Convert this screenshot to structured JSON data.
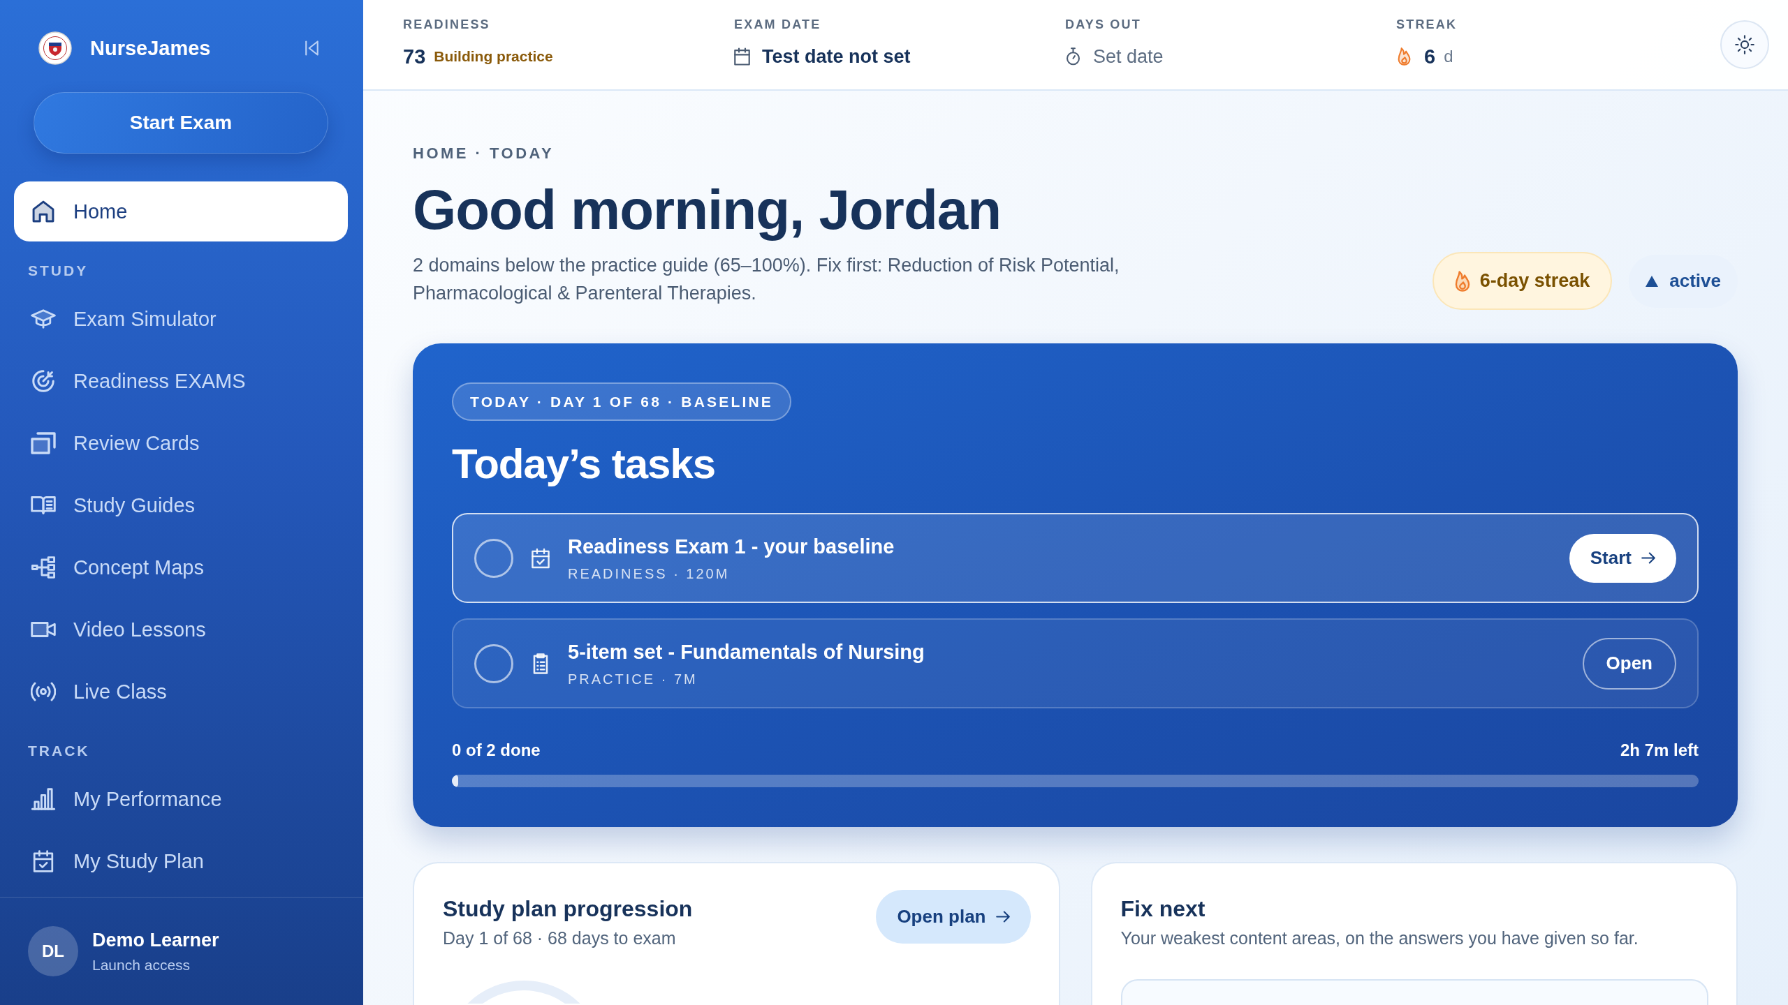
{
  "sidebar": {
    "brand": "NurseJames",
    "start_button": "Start Exam",
    "home": {
      "label": "Home",
      "selected": true
    },
    "sections": [
      {
        "heading": "STUDY",
        "items": [
          {
            "label": "Exam Simulator",
            "selected": false
          },
          {
            "label": "Readiness EXAMS",
            "selected": false
          },
          {
            "label": "Review Cards",
            "selected": false
          },
          {
            "label": "Study Guides",
            "selected": false
          },
          {
            "label": "Concept Maps",
            "selected": false
          },
          {
            "label": "Video Lessons",
            "selected": false
          },
          {
            "label": "Live Class",
            "selected": false
          }
        ]
      },
      {
        "heading": "TRACK",
        "items": [
          {
            "label": "My Performance",
            "selected": false
          },
          {
            "label": "My Study Plan",
            "selected": false
          }
        ]
      }
    ],
    "user": {
      "initials": "DL",
      "name": "Demo Learner",
      "plan": "Launch access"
    }
  },
  "top_bar": {
    "stats": [
      {
        "kind": "score",
        "label": "READINESS",
        "value": "73",
        "note": "Building practice"
      },
      {
        "kind": "date",
        "label": "EXAM DATE",
        "value": "Test date not set"
      },
      {
        "kind": "countdown",
        "label": "DAYS OUT",
        "value": "Set date"
      },
      {
        "kind": "streak",
        "label": "STREAK",
        "value": "6",
        "unit": "d"
      }
    ]
  },
  "header": {
    "breadcrumb": "HOME · TODAY",
    "title": "Good morning, Jordan",
    "summary": "2 domains below the practice guide (65–100%). Fix first: Reduction of Risk Potential, Pharmacological & Parenteral Therapies.",
    "streak_badge": "6-day streak",
    "status_badge": "active"
  },
  "tasks_card": {
    "tag": "TODAY · DAY 1 OF 68 · BASELINE",
    "title": "Today’s tasks",
    "tasks": [
      {
        "kind": "exam",
        "title": "Readiness Exam 1 - your baseline",
        "meta": "READINESS · 120M",
        "checked": false,
        "highlighted": true,
        "action": "Start"
      },
      {
        "kind": "practice",
        "title": "5-item set - Fundamentals of Nursing",
        "meta": "PRACTICE · 7M",
        "checked": false,
        "highlighted": false,
        "action": "Open"
      }
    ],
    "done_text": "0 of 2 done",
    "time_left": "2h 7m left",
    "progress": {
      "level": 0
    }
  },
  "plan_card": {
    "title": "Study plan progression",
    "subtitle": "Day 1 of 68 · 68 days to exam",
    "button": "Open plan"
  },
  "fix_card": {
    "title": "Fix next",
    "subtitle": "Your weakest content areas, on the answers you have given so far."
  }
}
